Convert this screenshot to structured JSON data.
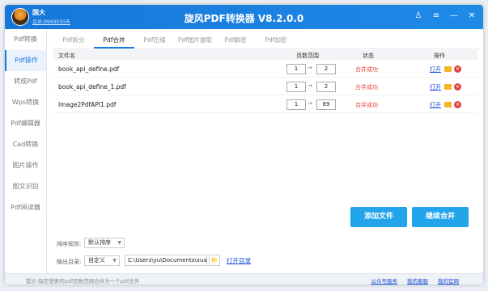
{
  "user": {
    "name": "国大",
    "vip": "会员:9999550天"
  },
  "title": "旋风PDF转换器 V8.2.0.0",
  "window_controls": [
    {
      "name": "skin-icon",
      "glyph": "♙"
    },
    {
      "name": "menu-icon",
      "glyph": "≡"
    },
    {
      "name": "minimize-icon",
      "glyph": "—"
    },
    {
      "name": "close-icon",
      "glyph": "✕"
    }
  ],
  "sidebar": {
    "items": [
      {
        "label": "Pdf转换"
      },
      {
        "label": "Pdf操作"
      },
      {
        "label": "转成Pdf"
      },
      {
        "label": "Wps转换"
      },
      {
        "label": "Pdf编辑器"
      },
      {
        "label": "Cad转换"
      },
      {
        "label": "图片操作"
      },
      {
        "label": "图文识别"
      },
      {
        "label": "Pdf阅读器"
      }
    ],
    "active_index": 1
  },
  "tabs": [
    {
      "label": "Pdf拆分"
    },
    {
      "label": "Pdf合并"
    },
    {
      "label": "Pdf压缩"
    },
    {
      "label": "Pdf图片提取"
    },
    {
      "label": "Pdf解密"
    },
    {
      "label": "Pdf加密"
    }
  ],
  "active_tab_index": 1,
  "table": {
    "headers": {
      "filename": "文件名",
      "pages": "页数范围",
      "status": "状态",
      "actions": "操作"
    },
    "rows": [
      {
        "filename": "book_api_define.pdf",
        "from": "1",
        "to": "2",
        "status": "合并成功",
        "open": "打开"
      },
      {
        "filename": "book_api_define_1.pdf",
        "from": "1",
        "to": "2",
        "status": "合并成功",
        "open": "打开"
      },
      {
        "filename": "Image2PdfAPI1.pdf",
        "from": "1",
        "to": "89",
        "status": "合并成功",
        "open": "打开"
      }
    ],
    "arrow": "→"
  },
  "buttons": {
    "add": "添加文件",
    "merge": "继续合并"
  },
  "sort": {
    "label": "排序规则:",
    "value": "默认排序"
  },
  "output": {
    "label": "输出目录:",
    "mode": "自定义",
    "path": "C:\\Users\\yu\\Documents\\xuanfe",
    "browse_icon": "folder-browse-icon",
    "open_dir": "打开目录"
  },
  "statusbar": {
    "hint": "提示:指定想要的pdf页数范围合并为一个pdf文件",
    "links": [
      "公众号服务",
      "我的客服",
      "我的官网"
    ]
  },
  "colors": {
    "accent": "#1a7ad9",
    "button": "#22a4ea",
    "success_text": "#e0443a",
    "link": "#1a4fd6"
  }
}
